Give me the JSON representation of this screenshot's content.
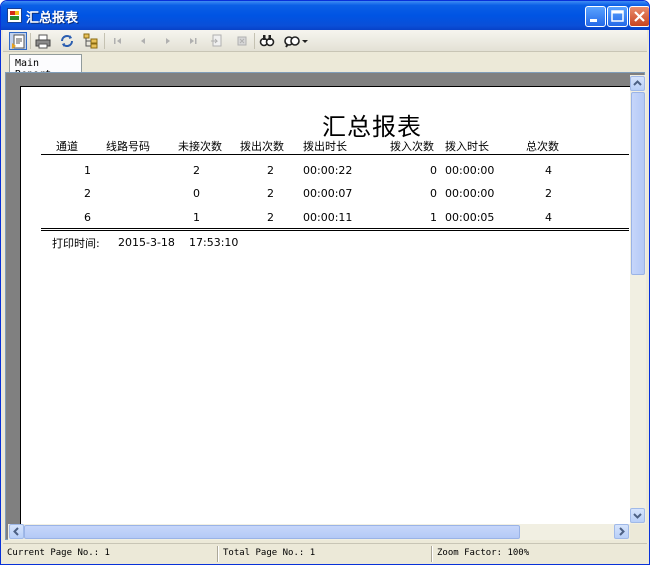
{
  "window": {
    "title": "汇总报表"
  },
  "toolbar": {
    "icons": [
      "export-icon",
      "print-icon",
      "refresh-icon",
      "tree-icon",
      "first-page-icon",
      "prev-page-icon",
      "next-page-icon",
      "last-page-icon",
      "goto-page-icon",
      "stop-icon",
      "search-icon",
      "zoom-icon"
    ]
  },
  "tabs": [
    {
      "label": "Main Report"
    }
  ],
  "report": {
    "title": "汇总报表",
    "columns": [
      "通道",
      "线路号码",
      "未接次数",
      "拨出次数",
      "拨出时长",
      "拨入次数",
      "拨入时长",
      "总次数"
    ],
    "rows": [
      [
        "1",
        "",
        "2",
        "2",
        "00:00:22",
        "0",
        "00:00:00",
        "4"
      ],
      [
        "2",
        "",
        "0",
        "2",
        "00:00:07",
        "0",
        "00:00:00",
        "2"
      ],
      [
        "6",
        "",
        "1",
        "2",
        "00:00:11",
        "1",
        "00:00:05",
        "4"
      ]
    ],
    "footer": {
      "label": "打印时间:",
      "date": "2015-3-18",
      "time": "17:53:10"
    }
  },
  "status": {
    "current_page": "Current Page No.: 1",
    "total_page": "Total Page No.: 1",
    "zoom": "Zoom Factor: 100%"
  },
  "colors": {
    "titlebar": "#0054e3",
    "page": "#ffffff",
    "viewer_bg": "#808080",
    "chrome": "#ece9d8"
  }
}
